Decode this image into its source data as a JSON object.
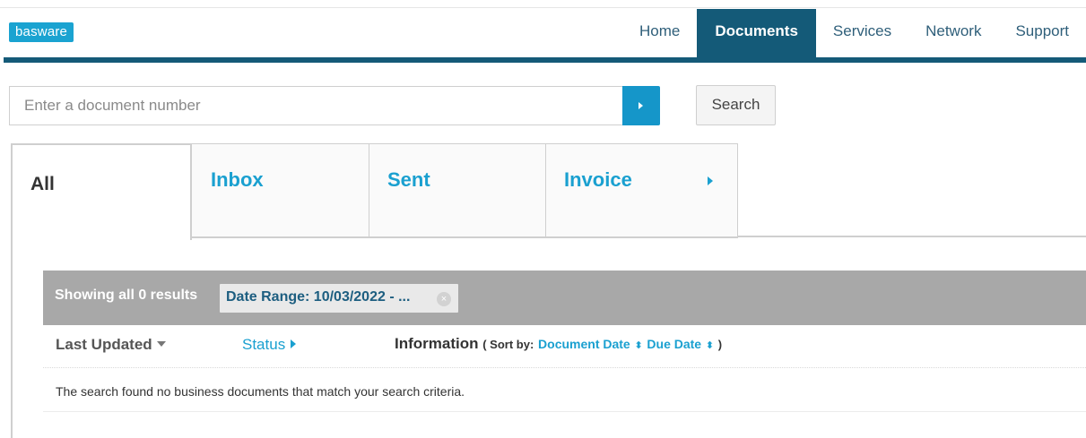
{
  "header": {
    "logo_text": "basware",
    "nav": [
      {
        "label": "Home",
        "active": false
      },
      {
        "label": "Documents",
        "active": true
      },
      {
        "label": "Services",
        "active": false
      },
      {
        "label": "Network",
        "active": false
      },
      {
        "label": "Support",
        "active": false
      }
    ]
  },
  "search": {
    "placeholder": "Enter a document number",
    "value": "",
    "button_label": "Search"
  },
  "tabs": [
    {
      "label": "All",
      "active": true
    },
    {
      "label": "Inbox",
      "active": false
    },
    {
      "label": "Sent",
      "active": false
    },
    {
      "label": "Invoice",
      "active": false
    }
  ],
  "results": {
    "showing_text": "Showing all 0 results",
    "filter_chip": "Date Range: 10/03/2022 - ...",
    "filter_close": "×"
  },
  "columns": {
    "last_updated": "Last Updated",
    "status": "Status",
    "information": "Information",
    "sort_prefix": "( Sort by:",
    "sort_document_date": "Document Date",
    "sort_due_date": "Due Date",
    "sort_suffix": ")",
    "updown_glyph": "⬍"
  },
  "empty_message": "The search found no business documents that match your search criteria.",
  "colors": {
    "brand_blue": "#1aa3d1",
    "nav_active_bg": "#145a78",
    "link_blue": "#1aa0d0",
    "results_bar_bg": "#a8a8a8"
  }
}
